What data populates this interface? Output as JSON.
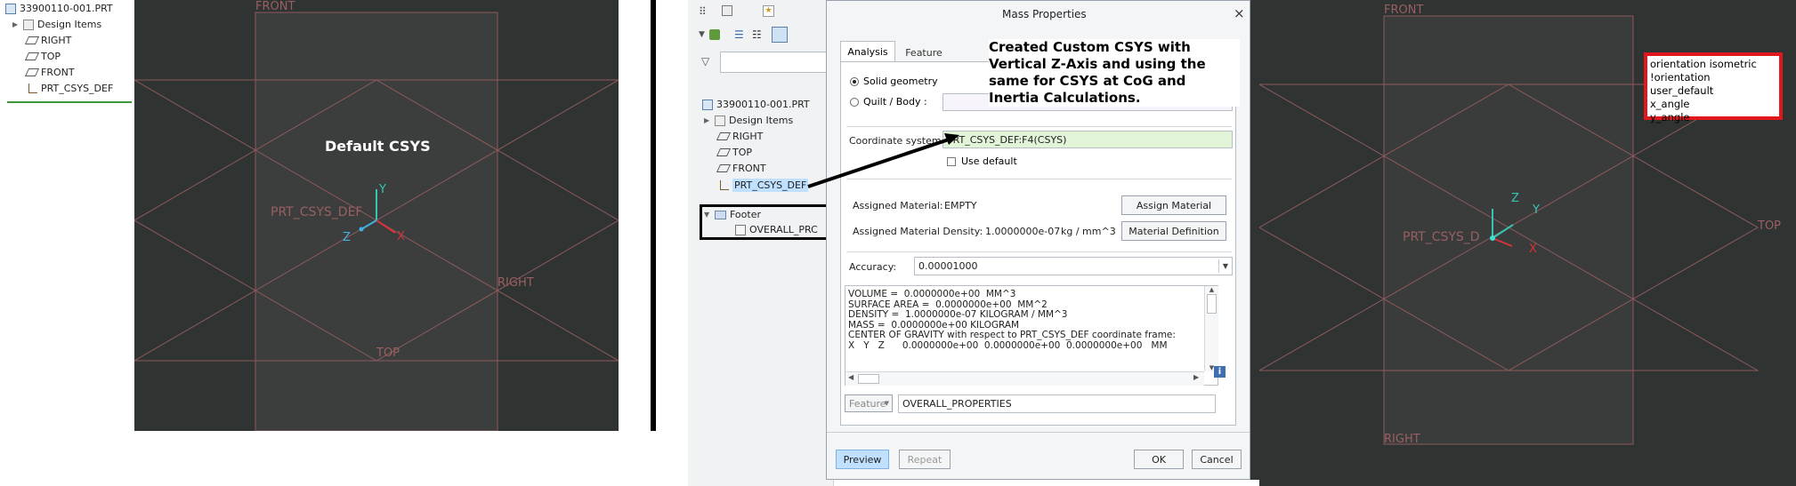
{
  "left_tree": {
    "root": "33900110-001.PRT",
    "items": [
      "Design Items",
      "RIGHT",
      "TOP",
      "FRONT",
      "PRT_CSYS_DEF"
    ]
  },
  "left_view": {
    "label_front": "FRONT",
    "label_right": "RIGHT",
    "label_top": "TOP",
    "label_csys": "PRT_CSYS_DEF",
    "axis_x": "X",
    "axis_y": "Y",
    "axis_z": "Z",
    "annotation": "Default CSYS"
  },
  "mid_tree": {
    "root": "33900110-001.PRT",
    "items": [
      "Design Items",
      "RIGHT",
      "TOP",
      "FRONT",
      "PRT_CSYS_DEF"
    ],
    "footer": "Footer",
    "footer_child": "OVERALL_PRC"
  },
  "dialog": {
    "title": "Mass Properties",
    "close": "×",
    "tabs": [
      "Analysis",
      "Feature"
    ],
    "solid_geometry": "Solid geometry",
    "quilt_body": "Quilt / Body :",
    "coord_label": "Coordinate system:",
    "coord_value": "PRT_CSYS_DEF:F4(CSYS)",
    "use_default": "Use default",
    "assigned_material_label": "Assigned Material:",
    "assigned_material_value": "EMPTY",
    "assign_material_btn": "Assign Material",
    "density_label": "Assigned Material Density:",
    "density_value": "1.0000000e-07",
    "density_unit": "kg / mm^3",
    "material_definition_btn": "Material Definition",
    "accuracy_label": "Accuracy:",
    "accuracy_value": "0.00001000",
    "results": [
      "VOLUME =  0.0000000e+00  MM^3",
      "SURFACE AREA =  0.0000000e+00  MM^2",
      "DENSITY =  1.0000000e-07 KILOGRAM / MM^3",
      "MASS =  0.0000000e+00 KILOGRAM",
      "CENTER OF GRAVITY with respect to PRT_CSYS_DEF coordinate frame:",
      "X   Y   Z      0.0000000e+00  0.0000000e+00  0.0000000e+00   MM"
    ],
    "feature_dropdown": "Feature",
    "feature_name": "OVERALL_PROPERTIES",
    "preview_btn": "Preview",
    "repeat_btn": "Repeat",
    "ok_btn": "OK",
    "cancel_btn": "Cancel"
  },
  "callout_text": "Created Custom CSYS with Vertical Z-Axis and using the same for CSYS at CoG and Inertia Calculations.",
  "right_view": {
    "label_front": "FRONT",
    "label_right": "RIGHT",
    "label_top": "TOP",
    "label_csys": "PRT_CSYS_D",
    "axis_x": "X",
    "axis_y": "Y",
    "axis_z": "Z"
  },
  "config_box": {
    "lines": [
      "orientation isometric",
      "!orientation user_default",
      "x_angle",
      "y_angle"
    ]
  },
  "colors": {
    "viewport_bg": "#2f3332",
    "datum_red": "#9a5f62",
    "highlight_green": "#e2f4d7",
    "selected_blue": "#bfe0ff",
    "callout_red": "#e0181e",
    "preview_blue": "#bfe0ff"
  }
}
